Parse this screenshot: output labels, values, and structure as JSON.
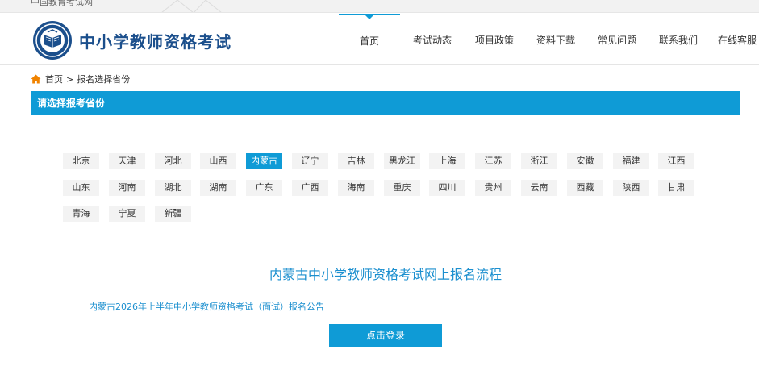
{
  "top_strip": {
    "site_name": "中国教育考试网"
  },
  "header": {
    "brand": "中小学教师资格考试",
    "nav": [
      {
        "label": "首页",
        "active": true
      },
      {
        "label": "考试动态",
        "active": false
      },
      {
        "label": "项目政策",
        "active": false
      },
      {
        "label": "资料下载",
        "active": false
      },
      {
        "label": "常见问题",
        "active": false
      },
      {
        "label": "联系我们",
        "active": false
      },
      {
        "label": "在线客服",
        "active": false
      }
    ]
  },
  "breadcrumb": {
    "home": "首页",
    "separator": ">",
    "current": "报名选择省份"
  },
  "select_bar": {
    "title": "请选择报考省份"
  },
  "provinces": {
    "selected": "内蒙古",
    "rows": [
      [
        "北京",
        "天津",
        "河北",
        "山西",
        "内蒙古",
        "辽宁",
        "吉林",
        "黑龙江",
        "上海",
        "江苏",
        "浙江",
        "安徽",
        "福建",
        "江西"
      ],
      [
        "山东",
        "河南",
        "湖北",
        "湖南",
        "广东",
        "广西",
        "海南",
        "重庆",
        "四川",
        "贵州",
        "云南",
        "西藏",
        "陕西",
        "甘肃"
      ],
      [
        "青海",
        "宁夏",
        "新疆"
      ]
    ]
  },
  "flow": {
    "title": "内蒙古中小学教师资格考试网上报名流程",
    "notice": "内蒙古2026年上半年中小学教师资格考试（面试）报名公告",
    "login_button": "点击登录"
  },
  "colors": {
    "accent": "#0f9bd6",
    "brand": "#1b4f8c",
    "link": "#1b8fcf",
    "home_icon": "#f08300"
  },
  "icons": {
    "logo": "book-emblem-logo",
    "home": "home-icon"
  }
}
